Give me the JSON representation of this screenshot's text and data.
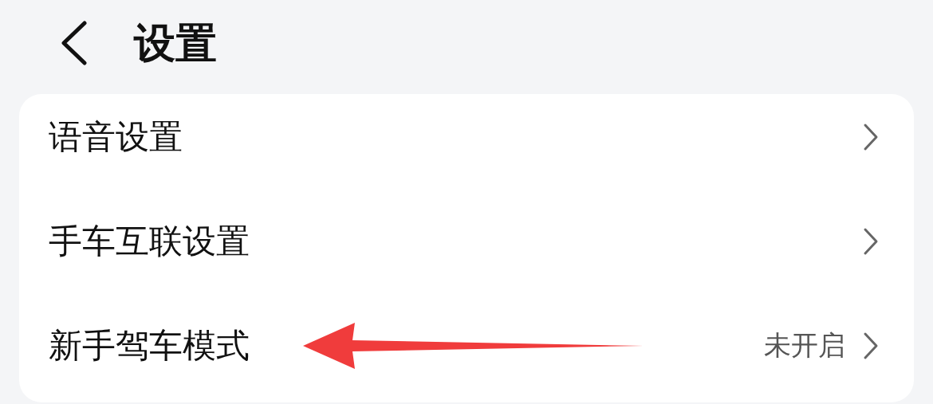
{
  "header": {
    "title": "设置"
  },
  "settings": {
    "items": [
      {
        "label": "语音设置"
      },
      {
        "label": "手车互联设置"
      },
      {
        "label": "新手驾车模式",
        "value": "未开启"
      }
    ]
  }
}
